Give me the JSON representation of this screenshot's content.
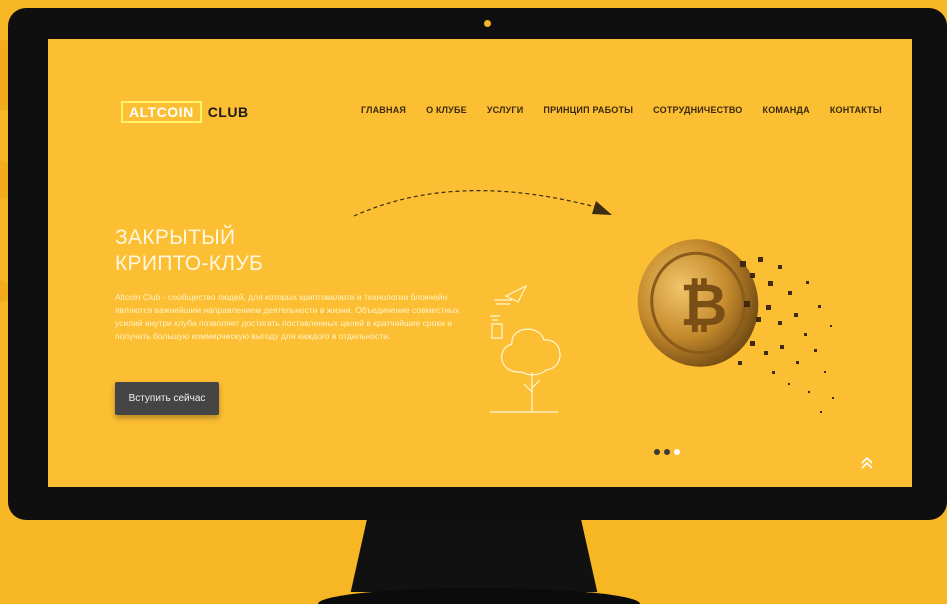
{
  "logo": {
    "part1": "ALTCOIN",
    "part2": "CLUB"
  },
  "nav": [
    "ГЛАВНАЯ",
    "О КЛУБЕ",
    "УСЛУГИ",
    "ПРИНЦИП РАБОТЫ",
    "СОТРУДНИЧЕСТВО",
    "КОМАНДА",
    "КОНТАКТЫ"
  ],
  "hero": {
    "title_line1": "ЗАКРЫТЫЙ",
    "title_line2": "КРИПТО-КЛУБ",
    "text": "Altcoin Club - сообщество людей, для которых криптовалюта и технологии блокчейн являются важнейшим направлением деятельности в жизни. Объединение совместных усилий внутри клуба позволяет достигать поставленных целей в кратчайшие сроки и получать большую коммерческую выгоду для каждого в отдельности.",
    "button_label": "Вступить сейчас"
  },
  "slider": {
    "count": 3,
    "active_index": 2
  },
  "colors": {
    "background": "#f7b724",
    "screen": "#fcbe32",
    "bezel": "#0f0f0f",
    "button": "#454545"
  },
  "icons": [
    "bitcoin-coin-icon",
    "tree-sketch-icon",
    "scroll-top-icon"
  ]
}
